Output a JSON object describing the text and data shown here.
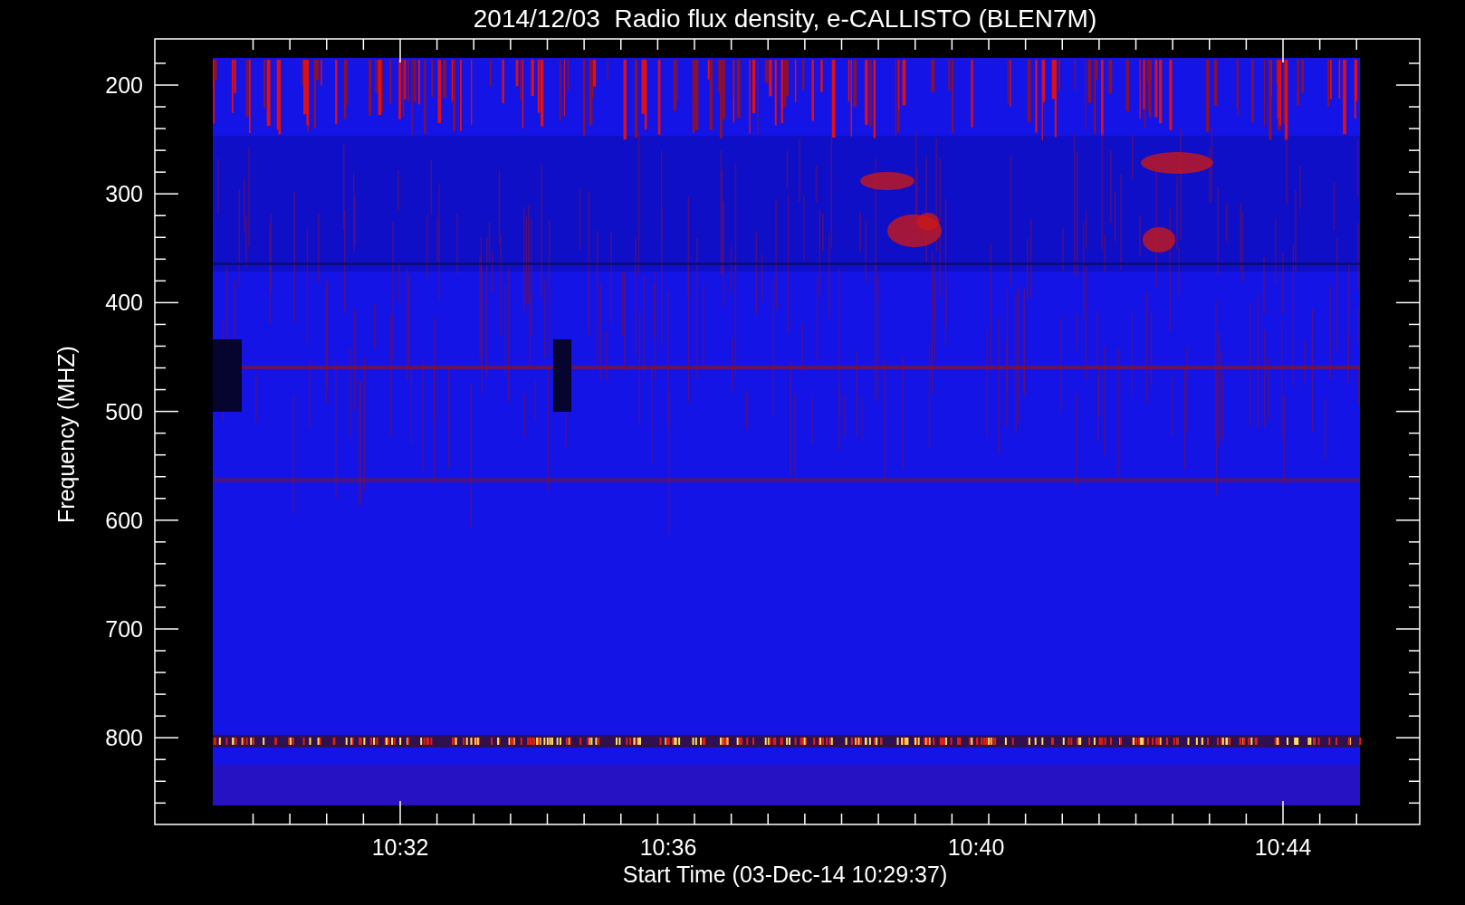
{
  "chart": {
    "title": "2014/12/03  Radio flux density, e-CALLISTO (BLEN7M)",
    "ylabel": "Frequency (MHZ)",
    "xlabel": "Start Time (03-Dec-14 10:29:37)",
    "yticks": [
      "200",
      "300",
      "400",
      "500",
      "600",
      "700",
      "800"
    ],
    "xticks": [
      "10:32",
      "10:36",
      "10:40",
      "10:44"
    ]
  }
}
